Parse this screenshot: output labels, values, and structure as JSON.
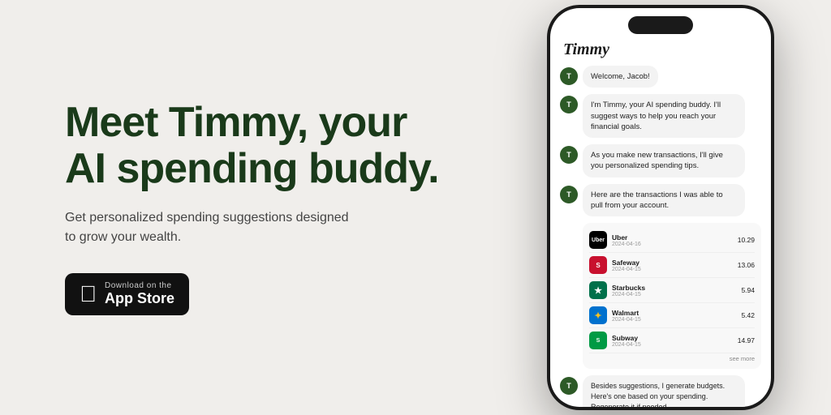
{
  "left": {
    "headline_line1": "Meet Timmy, your",
    "headline_line2": "AI spending buddy.",
    "subheadline": "Get personalized spending suggestions designed to grow your wealth.",
    "app_store_small": "Download on the",
    "app_store_big": "App Store"
  },
  "phone": {
    "title": "Timmy",
    "messages": [
      {
        "text": "Welcome, Jacob!"
      },
      {
        "text": "I'm Timmy, your AI spending buddy. I'll suggest ways to help you reach your financial goals."
      },
      {
        "text": "As you make new transactions, I'll give you personalized spending tips."
      },
      {
        "text": "Here are the transactions I was able to pull from your account."
      }
    ],
    "transactions": [
      {
        "name": "Uber",
        "date": "2024-04-16",
        "amount": "10.29",
        "logo": "uber",
        "symbol": "Uber"
      },
      {
        "name": "Safeway",
        "date": "2024-04-15",
        "amount": "13.06",
        "logo": "safeway",
        "symbol": "S"
      },
      {
        "name": "Starbucks",
        "date": "2024-04-15",
        "amount": "5.94",
        "logo": "starbucks",
        "symbol": "★"
      },
      {
        "name": "Walmart",
        "date": "2024-04-15",
        "amount": "5.42",
        "logo": "walmart",
        "symbol": "✦"
      },
      {
        "name": "Subway",
        "date": "2024-04-15",
        "amount": "14.97",
        "logo": "subway",
        "symbol": "S"
      }
    ],
    "see_more": "see more",
    "last_message": "Besides suggestions, I generate budgets. Here's one based on your spending. Regenerate it if needed."
  },
  "colors": {
    "bg": "#f0eeeb",
    "headline": "#1a3a1a",
    "phone_dark": "#1a1a1a"
  }
}
